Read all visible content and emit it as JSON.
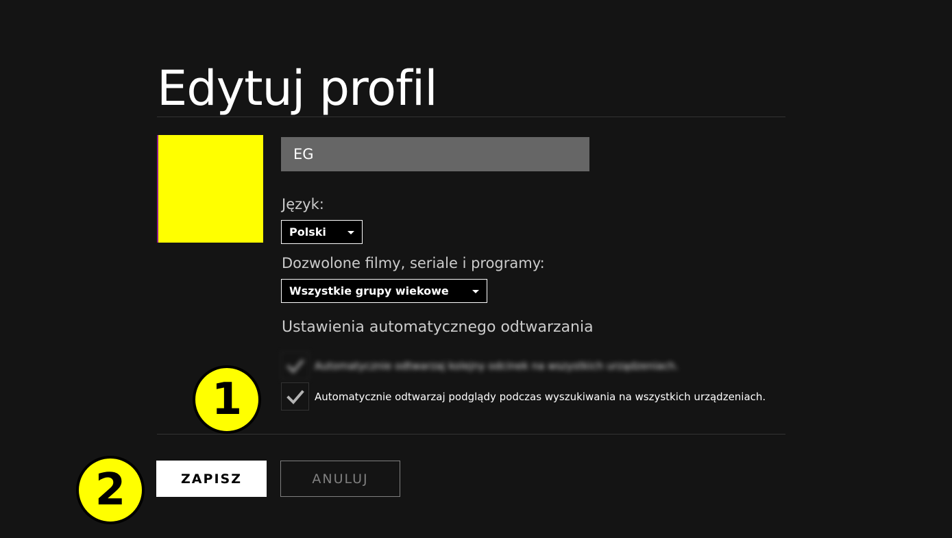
{
  "page": {
    "title": "Edytuj profil"
  },
  "profile": {
    "name_value": "EG"
  },
  "language": {
    "label": "Język:",
    "selected": "Polski"
  },
  "maturity": {
    "label": "Dozwolone filmy, seriale i programy:",
    "selected": "Wszystkie grupy wiekowe"
  },
  "autoplay": {
    "heading": "Ustawienia automatycznego odtwarzania",
    "option_1_label": "Automatycznie odtwarzaj kolejny odcinek na wszystkich urządzeniach.",
    "option_1_checked": true,
    "option_2_label": "Automatycznie odtwarzaj podglądy podczas wyszukiwania na wszystkich urządzeniach.",
    "option_2_checked": true
  },
  "actions": {
    "save_label": "ZAPISZ",
    "cancel_label": "ANULUJ"
  },
  "annotations": {
    "marker_1": "1",
    "marker_2": "2"
  },
  "icons": {
    "checkmark": "check-icon",
    "dropdown": "caret-down-icon"
  },
  "colors": {
    "background": "#141414",
    "avatar": "#ffff00",
    "input_bg": "#666666",
    "marker_bg": "#ffff00",
    "save_bg": "#ffffff",
    "check": "#b3b3b3"
  }
}
